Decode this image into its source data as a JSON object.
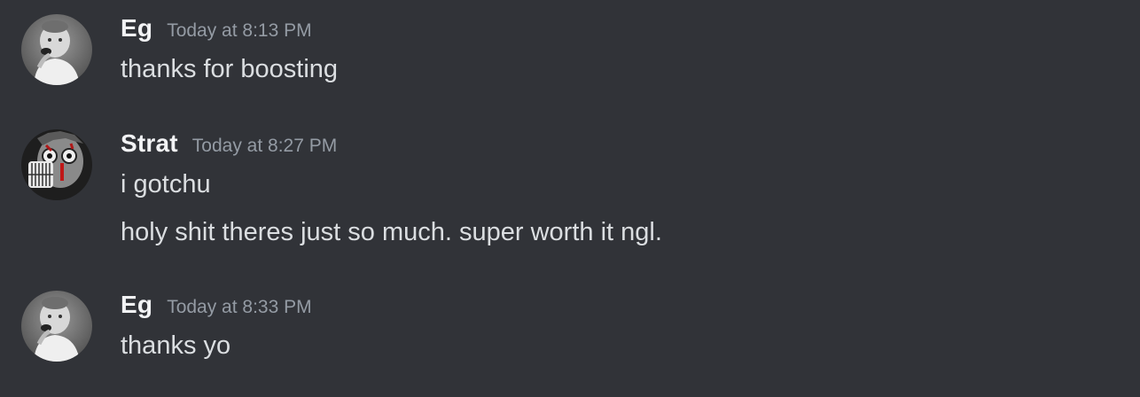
{
  "theme": {
    "background": "#313338",
    "username_color": "#f2f3f5",
    "timestamp_color": "#949ba4",
    "message_color": "#dbdee1"
  },
  "messages": [
    {
      "author": "Eg",
      "timestamp": "Today at 8:13 PM",
      "avatar_icon": "child-photo-avatar",
      "lines": [
        "thanks for boosting"
      ]
    },
    {
      "author": "Strat",
      "timestamp": "Today at 8:27 PM",
      "avatar_icon": "anime-character-avatar",
      "lines": [
        "i gotchu",
        "holy shit theres just so much. super worth it ngl."
      ]
    },
    {
      "author": "Eg",
      "timestamp": "Today at 8:33 PM",
      "avatar_icon": "child-photo-avatar",
      "lines": [
        "thanks yo"
      ]
    }
  ]
}
